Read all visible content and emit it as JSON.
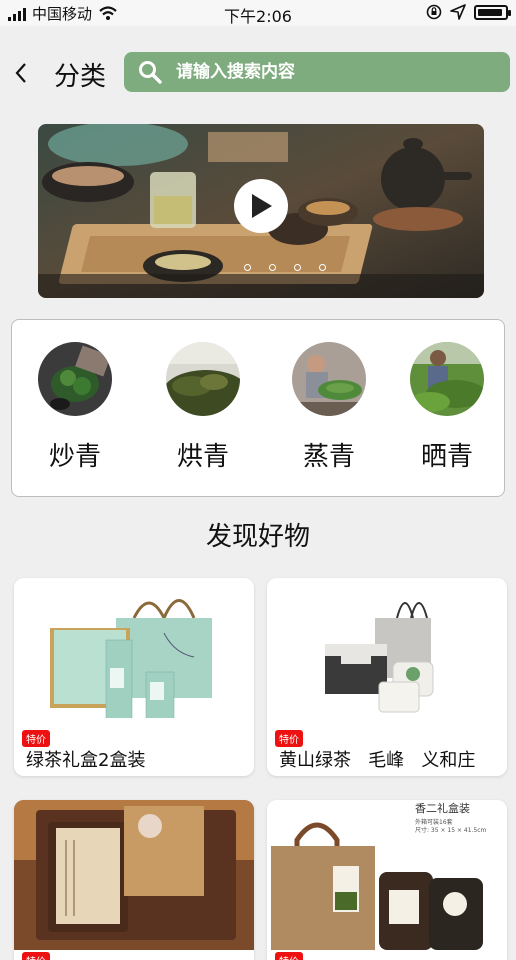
{
  "status_bar": {
    "carrier": "中国移动",
    "time": "下午2:06",
    "battery_level": 0.92,
    "icons": [
      "signal-icon",
      "wifi-icon",
      "rotation-lock-icon",
      "location-icon",
      "battery-icon"
    ]
  },
  "header": {
    "title": "分类",
    "search_placeholder": "请输入搜索内容"
  },
  "colors": {
    "accent": "#7fac7f",
    "tag_red": "#e11111",
    "background": "#efefef"
  },
  "banner": {
    "dots_count": 4
  },
  "categories": [
    {
      "label": "炒青"
    },
    {
      "label": "烘青"
    },
    {
      "label": "蒸青"
    },
    {
      "label": "晒青"
    }
  ],
  "section_title": "发现好物",
  "products": [
    {
      "tag": "特价",
      "name": "绿茶礼盒2盒装"
    },
    {
      "tag": "特价",
      "name": "黄山绿茶   毛峰   义和庄"
    },
    {
      "tag": "特价",
      "name": "",
      "image_text_lines": [
        "香二礼盒装",
        "外箱可装16套",
        "尺寸: 35 × 15 × 41.5cm"
      ]
    },
    {
      "tag": "特价",
      "name": ""
    }
  ]
}
